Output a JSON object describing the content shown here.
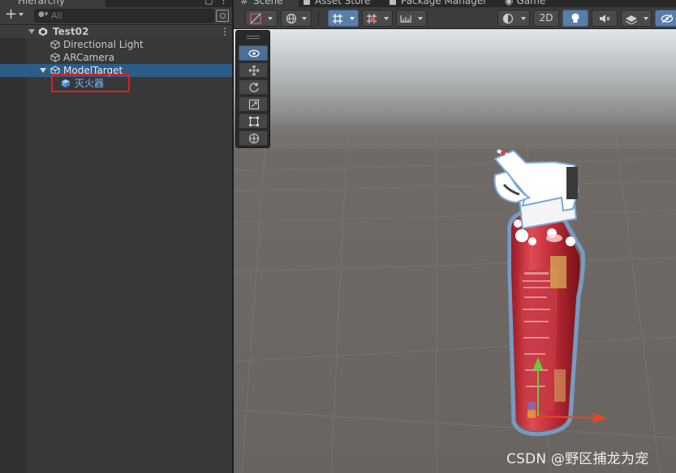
{
  "hierarchy": {
    "tab_label": "Hierarchy",
    "search_placeholder": "All",
    "scene_name": "Test02",
    "items": [
      {
        "label": "Directional Light"
      },
      {
        "label": "ARCamera"
      },
      {
        "label": "ModelTarget"
      },
      {
        "label": "灭火器"
      }
    ]
  },
  "scene_tabs": [
    {
      "label": "Scene"
    },
    {
      "label": "Asset Store"
    },
    {
      "label": "Package Manager"
    },
    {
      "label": "Game"
    }
  ],
  "scene_toolbar": {
    "mode_2d_label": "2D"
  },
  "colors": {
    "selection": "#2c5d87",
    "highlight_box": "#e01d1d",
    "active_tool": "#4e6f94",
    "sky": "#dfe6ea",
    "ground": "#6e6a66"
  },
  "icons": [
    "plus-icon",
    "search-icon",
    "filter-icon",
    "unity-icon",
    "cube-icon",
    "kebab-icon",
    "eye-icon",
    "move-icon",
    "rotate-icon",
    "scale-icon",
    "rect-icon",
    "transform-icon",
    "lightbulb-icon",
    "audio-icon",
    "effects-icon",
    "gizmo-icon"
  ],
  "watermark": "CSDN @野区捕龙为宠"
}
